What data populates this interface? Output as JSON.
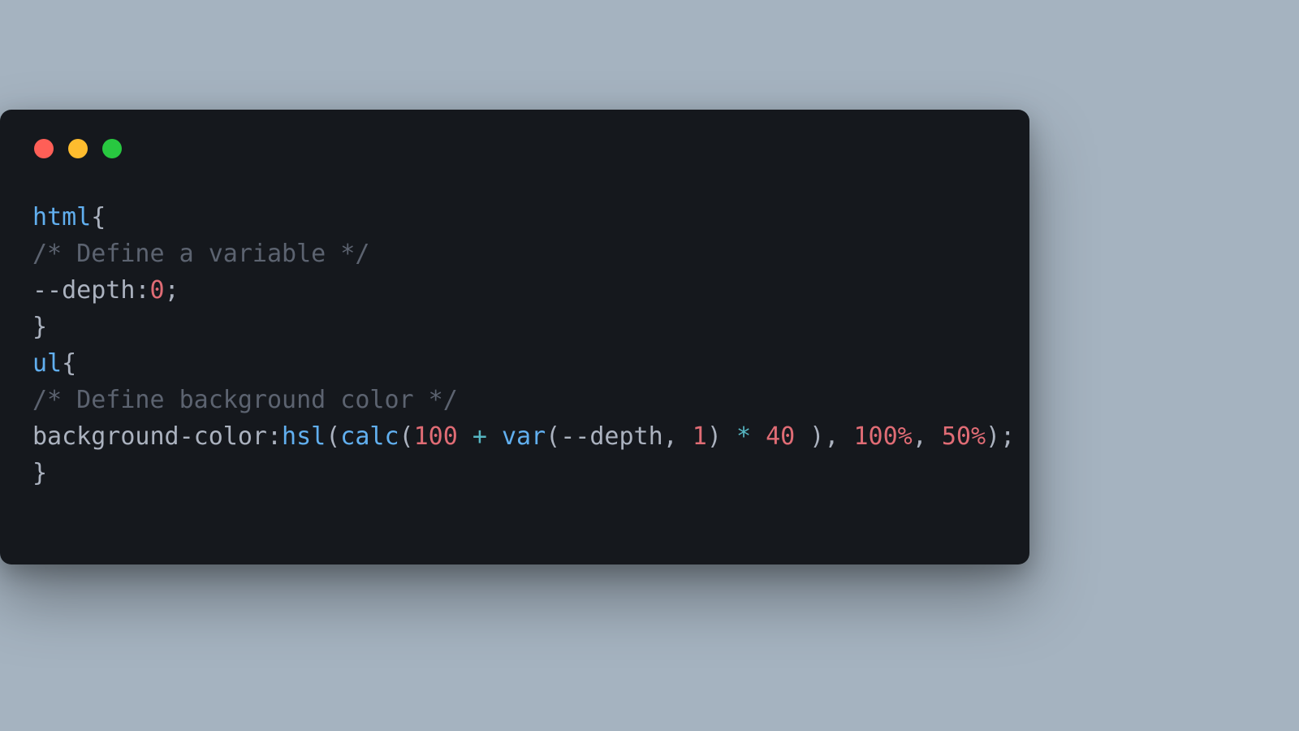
{
  "window": {
    "traffic": {
      "close_color": "#ff5f57",
      "minimize_color": "#febc2e",
      "zoom_color": "#28c840"
    }
  },
  "code": {
    "l1_sel": "html",
    "l1_brace": "{",
    "l2_comment": "/* Define a variable */",
    "l3_prop": "--depth",
    "l3_colon": ":",
    "l3_val": "0",
    "l3_semi": ";",
    "l4_brace": "}",
    "l5_sel": "ul",
    "l5_brace": "{",
    "l6_comment": "/* Define background color */",
    "l7_prop": "background-color",
    "l7_colon": ":",
    "l7_fn_hsl": "hsl",
    "l7_p1": "(",
    "l7_fn_calc": "calc",
    "l7_p2": "(",
    "l7_n100": "100",
    "l7_plus": " + ",
    "l7_fn_var": "var",
    "l7_p3": "(",
    "l7_varname": "--depth",
    "l7_comma1": ", ",
    "l7_n1": "1",
    "l7_p3c": ")",
    "l7_star": " * ",
    "l7_n40": "40",
    "l7_sp40": " ",
    "l7_p2c": ")",
    "l7_comma2": ", ",
    "l7_n100p": "100%",
    "l7_comma3": ", ",
    "l7_n50p": "50%",
    "l7_p1c": ")",
    "l7_semi": ";",
    "l8_brace": "}"
  }
}
